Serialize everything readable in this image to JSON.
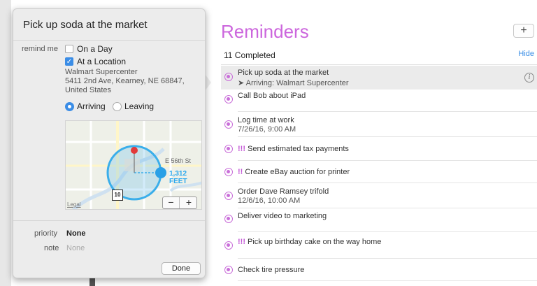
{
  "list": {
    "title": "Reminders",
    "add_label": "+",
    "completed_count": "11 Completed",
    "hide_label": "Hide",
    "accent_color": "#cc66dd",
    "items": [
      {
        "title": "Pick up soda at the market",
        "priority": "",
        "subtitle": "➤ Arriving: Walmart Supercenter"
      },
      {
        "title": "Call Bob about iPad",
        "priority": "",
        "subtitle": ""
      },
      {
        "title": "Log time at work",
        "priority": "",
        "subtitle": "7/26/16, 9:00 AM"
      },
      {
        "title": "Send estimated tax payments",
        "priority": "!!!",
        "subtitle": ""
      },
      {
        "title": "Create eBay auction for printer",
        "priority": "!!",
        "subtitle": ""
      },
      {
        "title": "Order Dave Ramsey trifold",
        "priority": "",
        "subtitle": "12/6/16, 10:00 AM"
      },
      {
        "title": "Deliver video to marketing",
        "priority": "",
        "subtitle": ""
      },
      {
        "title": "Pick up birthday cake on the way home",
        "priority": "!!!",
        "subtitle": ""
      },
      {
        "title": "Check tire pressure",
        "priority": "",
        "subtitle": ""
      }
    ],
    "info_icon": "i"
  },
  "popover": {
    "title": "Pick up soda at the market",
    "remind_me_label": "remind me",
    "on_a_day_label": "On a Day",
    "on_a_day_checked": false,
    "at_location_label": "At a Location",
    "at_location_checked": true,
    "address": {
      "line1": "Walmart Supercenter",
      "line2": "5411 2nd Ave, Kearney, NE 68847,",
      "line3": "United States"
    },
    "arriving_label": "Arriving",
    "leaving_label": "Leaving",
    "selected_trigger": "Arriving",
    "map": {
      "street_label": "E 56th St",
      "distance_label": "1,312 FEET",
      "highway_shield": "10",
      "legal_label": "Legal",
      "zoom_out": "−",
      "zoom_in": "+"
    },
    "priority_label": "priority",
    "priority_value": "None",
    "note_label": "note",
    "note_placeholder": "None",
    "done_label": "Done"
  }
}
